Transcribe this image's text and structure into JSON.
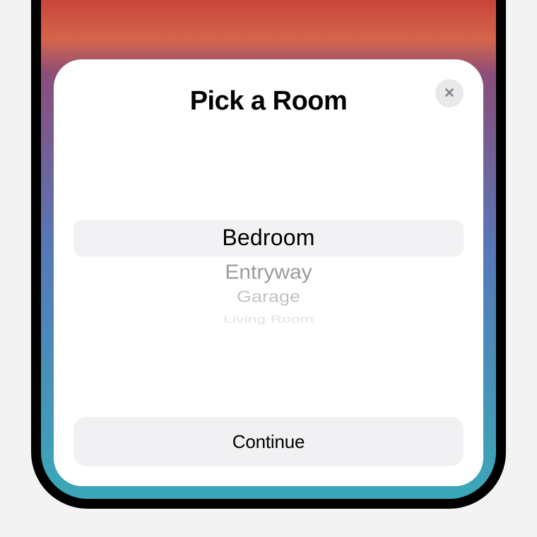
{
  "modal": {
    "title": "Pick a Room",
    "close_label": "Close",
    "picker": {
      "selected": "Bedroom",
      "items": [
        "Bedroom",
        "Entryway",
        "Garage",
        "Living Room"
      ]
    },
    "continue_label": "Continue"
  },
  "colors": {
    "modal_bg": "#ffffff",
    "button_bg": "#f1f1f3",
    "close_bg": "#e9e9eb",
    "highlight_bg": "#f2f2f4"
  }
}
